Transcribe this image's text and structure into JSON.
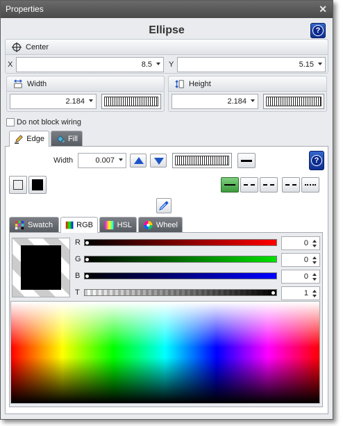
{
  "window": {
    "title": "Properties",
    "close_glyph": "✕"
  },
  "heading": "Ellipse",
  "help_glyph": "?",
  "center": {
    "label": "Center",
    "x_label": "X",
    "x_value": "8.5",
    "y_label": "Y",
    "y_value": "5.15"
  },
  "width_group": {
    "label": "Width",
    "value": "2.184"
  },
  "height_group": {
    "label": "Height",
    "value": "2.184"
  },
  "wiring_checkbox": {
    "label": "Do not block wiring",
    "checked": false
  },
  "tabs": [
    {
      "label": "Edge",
      "icon": "pen-icon",
      "active": true
    },
    {
      "label": "Fill",
      "icon": "paint-bucket-icon",
      "active": false
    }
  ],
  "edge": {
    "width_label": "Width",
    "width_value": "0.007"
  },
  "color_tabs": [
    {
      "label": "Swatch",
      "icon": "swatch-grid-icon",
      "active": false
    },
    {
      "label": "RGB",
      "icon": "rgb-gradient-icon",
      "active": true
    },
    {
      "label": "HSL",
      "icon": "hsl-gradient-icon",
      "active": false
    },
    {
      "label": "Wheel",
      "icon": "color-wheel-icon",
      "active": false
    }
  ],
  "rgb": {
    "channels": [
      {
        "label": "R",
        "value": "0",
        "level": 0,
        "color": "#ff0000"
      },
      {
        "label": "G",
        "value": "0",
        "level": 0,
        "color": "#00e000"
      },
      {
        "label": "B",
        "value": "0",
        "level": 0,
        "color": "#0000ff"
      },
      {
        "label": "T",
        "value": "1",
        "level": 1,
        "color": "#000000"
      }
    ]
  },
  "current_color": "#000000",
  "colors": {
    "accent": "#1d55c9",
    "active_dash": "#3c9a3c"
  }
}
